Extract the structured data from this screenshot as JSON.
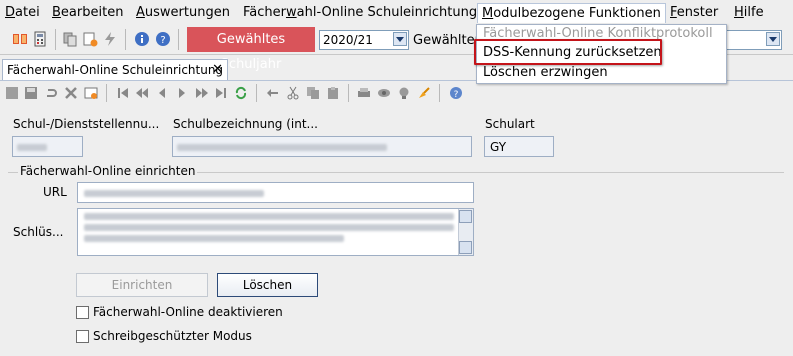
{
  "menubar": {
    "items": [
      {
        "label": "Datei",
        "mnemonic": "D"
      },
      {
        "label": "Bearbeiten",
        "mnemonic": "B"
      },
      {
        "label": "Auswertungen",
        "mnemonic": "A"
      },
      {
        "label": "Fächerwahl-Online Schuleinrichtung",
        "mnemonic": "w"
      },
      {
        "label": "Modulbezogene Funktionen",
        "mnemonic": "M"
      },
      {
        "label": "Fenster",
        "mnemonic": "F"
      },
      {
        "label": "Hilfe",
        "mnemonic": "H"
      }
    ]
  },
  "toolbar": {
    "schuljahr_button": "Gewähltes Schuljahr",
    "schuljahr_value": "2020/21",
    "gewaehlter_label": "Gewählter"
  },
  "dropdown": {
    "items": [
      {
        "label": "Fächerwahl-Online Konfliktprotokoll",
        "enabled": false
      },
      {
        "label": "DSS-Kennung zurücksetzen",
        "enabled": true,
        "highlighted": true
      },
      {
        "label": "Löschen erzwingen",
        "enabled": true
      }
    ]
  },
  "tab": {
    "label": "Fächerwahl-Online Schuleinrichtung",
    "close": "✕"
  },
  "form": {
    "schul_nr_label": "Schul-/Dienststellennu...",
    "schulbez_label": "Schulbezeichnung (int...",
    "schulart_label": "Schulart",
    "schulart_value": "GY",
    "section_title": "Fächerwahl-Online einrichten",
    "url_label": "URL",
    "schluessel_label": "Schlüs...",
    "einrichten_button": "Einrichten",
    "loeschen_button": "Löschen",
    "checkbox_deaktivieren": "Fächerwahl-Online deaktivieren",
    "checkbox_schreibgeschuetzt": "Schreibgeschützter Modus"
  },
  "colors": {
    "accent_red": "#d9545a",
    "highlight_box": "#c4141a",
    "background": "#eeeeee"
  }
}
